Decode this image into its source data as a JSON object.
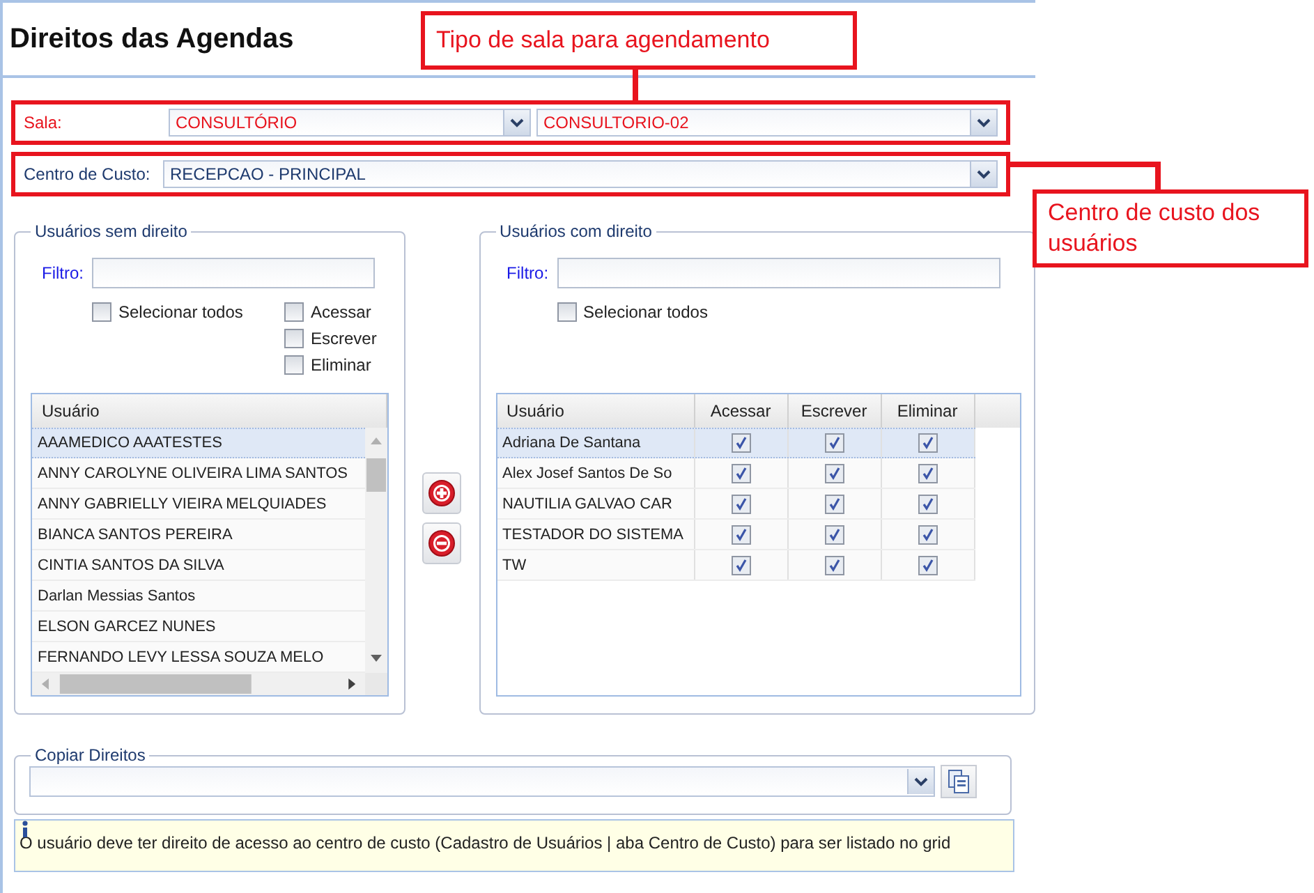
{
  "title": "Direitos das Agendas",
  "annotations": [
    {
      "text": "Tipo de sala para agendamento"
    },
    {
      "text": "Centro de custo dos usuários"
    }
  ],
  "sala": {
    "label": "Sala:",
    "type_value": "CONSULTÓRIO",
    "room_value": "CONSULTORIO-02"
  },
  "centro": {
    "label": "Centro de Custo:",
    "value": "RECEPCAO - PRINCIPAL"
  },
  "left": {
    "legend": "Usuários sem direito",
    "filter_label": "Filtro:",
    "select_all": {
      "label": "Selecionar todos",
      "checked": false
    },
    "permissions": [
      {
        "label": "Acessar",
        "checked": false
      },
      {
        "label": "Escrever",
        "checked": false
      },
      {
        "label": "Eliminar",
        "checked": false
      }
    ],
    "column": "Usuário",
    "rows": [
      {
        "name": "AAAMEDICO AAATESTES",
        "selected": true
      },
      {
        "name": "ANNY CAROLYNE OLIVEIRA LIMA SANTOS",
        "selected": false
      },
      {
        "name": "ANNY GABRIELLY VIEIRA MELQUIADES",
        "selected": false
      },
      {
        "name": "BIANCA SANTOS PEREIRA",
        "selected": false
      },
      {
        "name": "CINTIA SANTOS DA SILVA",
        "selected": false
      },
      {
        "name": "Darlan Messias Santos",
        "selected": false
      },
      {
        "name": "ELSON GARCEZ NUNES",
        "selected": false
      },
      {
        "name": "FERNANDO LEVY LESSA SOUZA MELO",
        "selected": false
      }
    ]
  },
  "right": {
    "legend": "Usuários com direito",
    "filter_label": "Filtro:",
    "select_all": {
      "label": "Selecionar todos",
      "checked": false
    },
    "columns": [
      "Usuário",
      "Acessar",
      "Escrever",
      "Eliminar"
    ],
    "rows": [
      {
        "name": "Adriana De Santana",
        "selected": true,
        "acessar": true,
        "escrever": true,
        "eliminar": true
      },
      {
        "name": "Alex Josef Santos De So",
        "selected": false,
        "acessar": true,
        "escrever": true,
        "eliminar": true
      },
      {
        "name": "NAUTILIA GALVAO CAR",
        "selected": false,
        "acessar": true,
        "escrever": true,
        "eliminar": true
      },
      {
        "name": "TESTADOR DO SISTEMA",
        "selected": false,
        "acessar": true,
        "escrever": true,
        "eliminar": true
      },
      {
        "name": "TW",
        "selected": false,
        "acessar": true,
        "escrever": true,
        "eliminar": true
      }
    ]
  },
  "copy": {
    "legend": "Copiar Direitos"
  },
  "info": "O usuário deve ter direito de acesso ao centro de custo (Cadastro de Usuários | aba Centro de Custo) para ser listado no grid"
}
